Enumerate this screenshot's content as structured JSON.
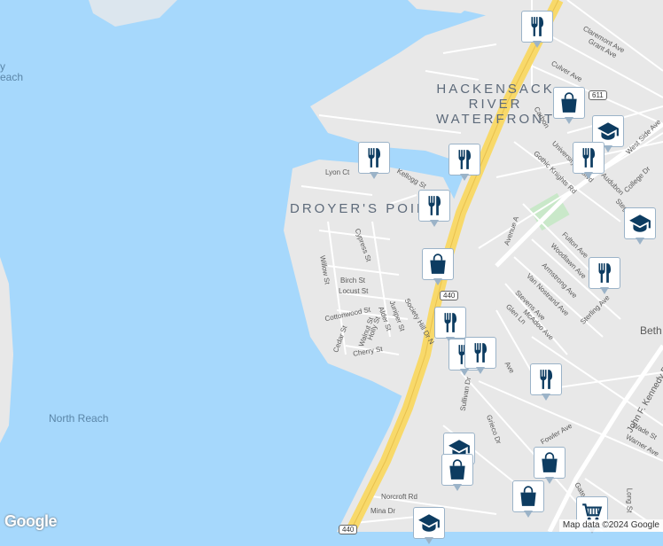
{
  "map": {
    "area_labels": [
      {
        "id": "hackensack",
        "lines": [
          "HACKENSACK",
          "RIVER",
          "WATERFRONT"
        ]
      },
      {
        "id": "droyers",
        "lines": [
          "DROYER'S POINT"
        ]
      }
    ],
    "water_labels": [
      "North Reach",
      "y",
      "each"
    ],
    "streets": [
      "Lyon Ct",
      "Kellogg St",
      "Cypress St",
      "Willow St",
      "Birch St",
      "Locust St",
      "Cottonwood St",
      "Cedar St",
      "Walnut St",
      "Alder St",
      "Holly St",
      "Juniper St",
      "Society Hill Dr N",
      "Cherry St",
      "Sullivan Dr",
      "Grieco Dr",
      "Norcroft Rd",
      "Mina Dr",
      "Claremont Ave",
      "Grant Ave",
      "Culver Ave",
      "Carbon",
      "Gothic Knights Rd",
      "University Pl Blvd",
      "West Side Ave",
      "College Dr",
      "Audubon",
      "Stegman Pkwy",
      "Avenue A",
      "Fulton Ave",
      "Woodlawn Ave",
      "Armstrong Ave",
      "Van Nostrand Ave",
      "Stevens Ave",
      "Glen Ln",
      "McAdoo Ave",
      "Sterling Ave",
      "John F. Kennedy Blvd",
      "Fowler Ave",
      "Warner Ave",
      "Wade St",
      "Long St",
      "Gate",
      "Ave",
      "Beth"
    ],
    "shields": [
      "611",
      "440",
      "440"
    ],
    "pois": [
      {
        "type": "restaurant"
      },
      {
        "type": "shopping"
      },
      {
        "type": "school"
      },
      {
        "type": "restaurant"
      },
      {
        "type": "restaurant"
      },
      {
        "type": "restaurant"
      },
      {
        "type": "restaurant"
      },
      {
        "type": "shopping"
      },
      {
        "type": "school"
      },
      {
        "type": "restaurant"
      },
      {
        "type": "restaurant"
      },
      {
        "type": "restaurant"
      },
      {
        "type": "restaurant"
      },
      {
        "type": "restaurant"
      },
      {
        "type": "school"
      },
      {
        "type": "shopping"
      },
      {
        "type": "shopping"
      },
      {
        "type": "shopping"
      },
      {
        "type": "grocery"
      },
      {
        "type": "school"
      }
    ],
    "colors": {
      "water": "#a6d8fc",
      "land": "#e8e8e8",
      "highway": "#f8d96a",
      "road": "#ffffff",
      "park": "#c9e8c9",
      "icon": "#0d3c61"
    }
  },
  "footer": {
    "logo": "Google",
    "attribution": "Map data ©2024 Google"
  }
}
